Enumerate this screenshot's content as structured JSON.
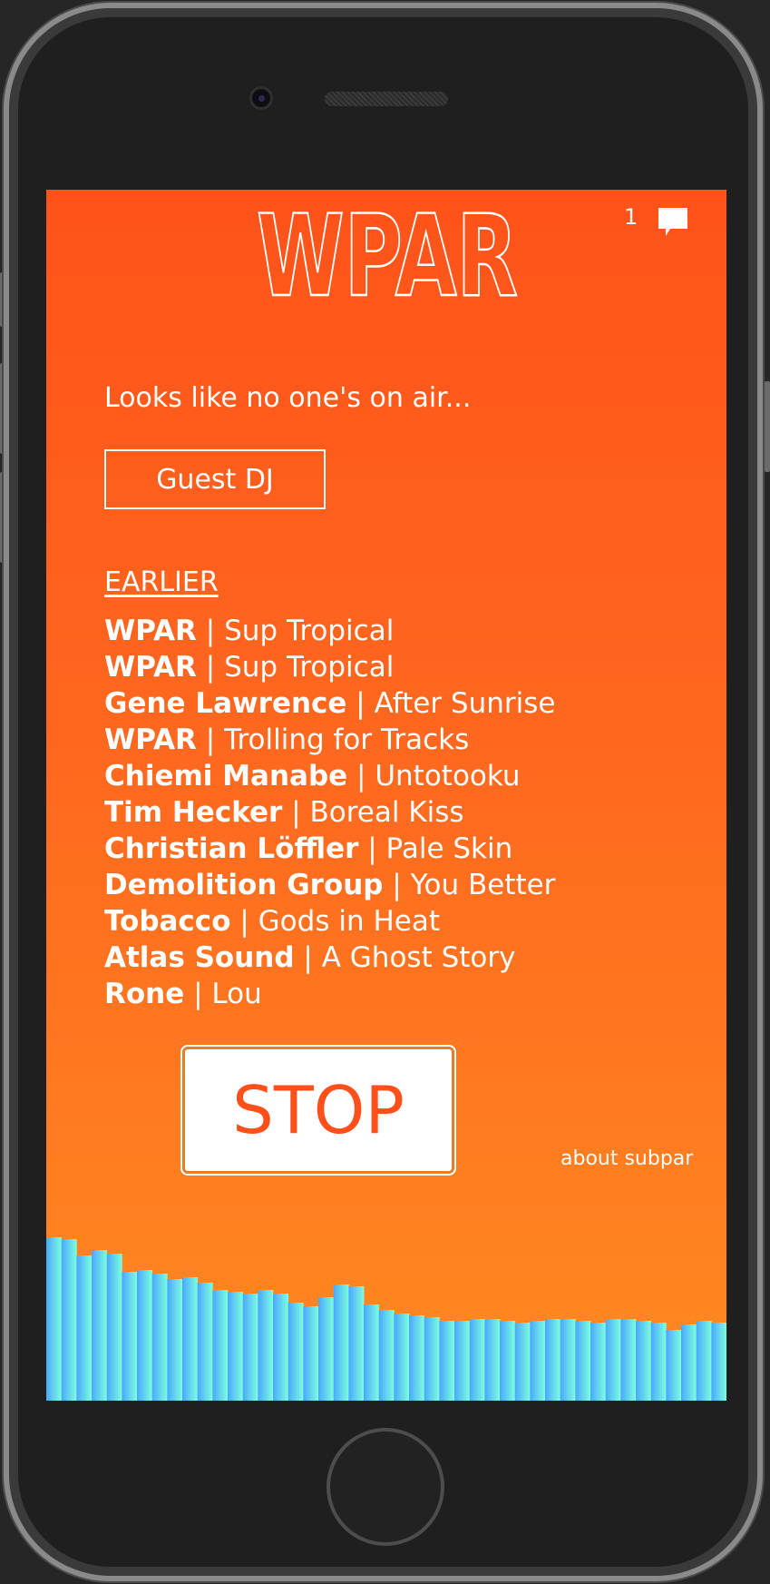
{
  "header": {
    "logo_text": "WPAR",
    "chat_count": "1"
  },
  "status": {
    "message": "Looks like no one's on air..."
  },
  "guest_dj_label": "Guest DJ",
  "earlier": {
    "heading": "EARLIER",
    "tracks": [
      {
        "artist": "WPAR",
        "title": "Sup Tropical"
      },
      {
        "artist": "WPAR",
        "title": "Sup Tropical"
      },
      {
        "artist": "Gene Lawrence",
        "title": "After Sunrise"
      },
      {
        "artist": "WPAR",
        "title": "Trolling for Tracks"
      },
      {
        "artist": "Chiemi Manabe",
        "title": "Untotooku"
      },
      {
        "artist": "Tim Hecker",
        "title": "Boreal Kiss"
      },
      {
        "artist": "Christian Löffler",
        "title": "Pale Skin"
      },
      {
        "artist": "Demolition Group",
        "title": "You Better"
      },
      {
        "artist": "Tobacco",
        "title": "Gods in Heat"
      },
      {
        "artist": "Atlas Sound",
        "title": "A Ghost Story"
      },
      {
        "artist": "Rone",
        "title": "Lou"
      }
    ]
  },
  "stop_label": "STOP",
  "about_link": "about subpar",
  "colors": {
    "screen_top": "#ff5219",
    "screen_bottom": "#ff8a20",
    "stop_text": "#ff4f1a",
    "visualizer_start": "#4aa8ff",
    "visualizer_end": "#7dffdc"
  },
  "visualizer": {
    "levels": [
      0.9,
      0.89,
      0.8,
      0.83,
      0.81,
      0.71,
      0.72,
      0.7,
      0.67,
      0.68,
      0.65,
      0.61,
      0.6,
      0.59,
      0.61,
      0.59,
      0.54,
      0.52,
      0.57,
      0.64,
      0.63,
      0.53,
      0.5,
      0.48,
      0.47,
      0.46,
      0.44,
      0.44,
      0.45,
      0.45,
      0.44,
      0.43,
      0.44,
      0.45,
      0.45,
      0.44,
      0.43,
      0.45,
      0.45,
      0.44,
      0.43,
      0.39,
      0.42,
      0.44,
      0.43
    ]
  }
}
